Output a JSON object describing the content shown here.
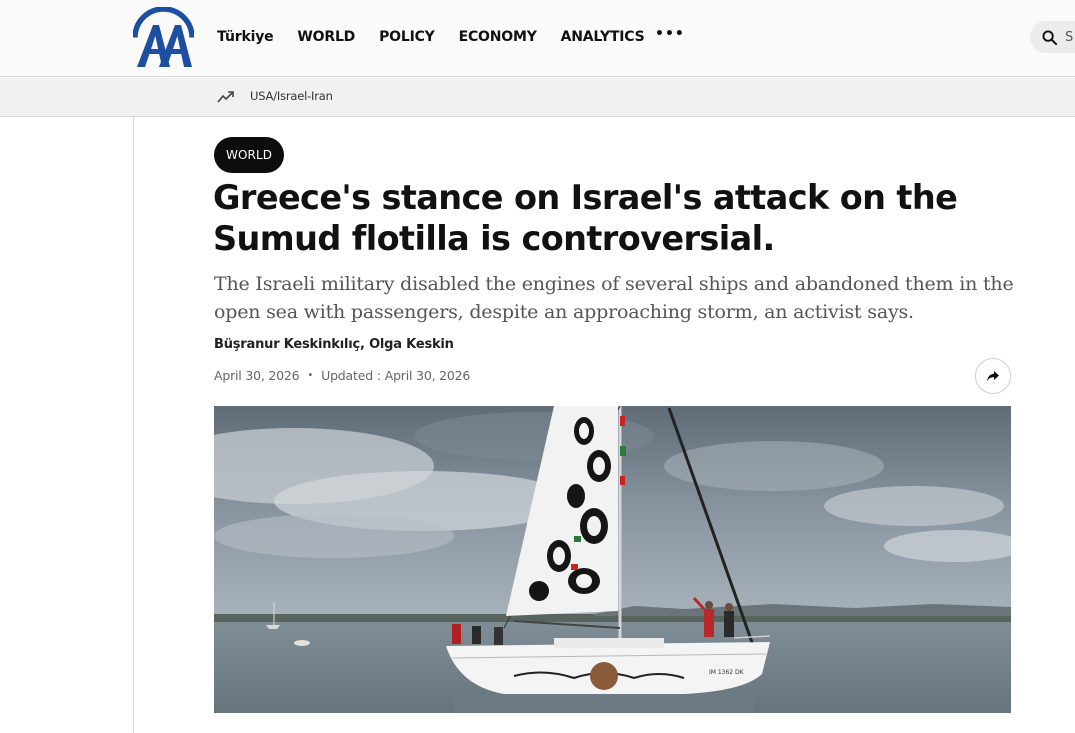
{
  "header": {
    "logo_text": "AA",
    "nav": [
      "Türkiye",
      "WORLD",
      "POLICY",
      "ECONOMY",
      "ANALYTICS"
    ],
    "more_label": "•••",
    "search_label": "S"
  },
  "trending": {
    "label": "USA/Israel-Iran"
  },
  "article": {
    "category": "WORLD",
    "headline": "Greece's stance on Israel's attack on the Sumud flotilla is controversial.",
    "summary": "The Israeli military disabled the engines of several ships and abandoned them in the open sea with passengers, despite an approaching storm, an activist says.",
    "authors": "Büşranur Keskinkılıç, Olga Keskin",
    "published": "April 30, 2026",
    "updated_label": "Updated :",
    "updated": "April 30, 2026",
    "hero_hull_text": "IM 1362 DK"
  },
  "colors": {
    "text": "#111111",
    "badge_bg": "#0d0d0d",
    "logo_blue": "#1c4fa1",
    "summary_gray": "#555555"
  },
  "icons": [
    "aa-logo-icon",
    "search-icon",
    "trending-icon",
    "share-icon"
  ]
}
